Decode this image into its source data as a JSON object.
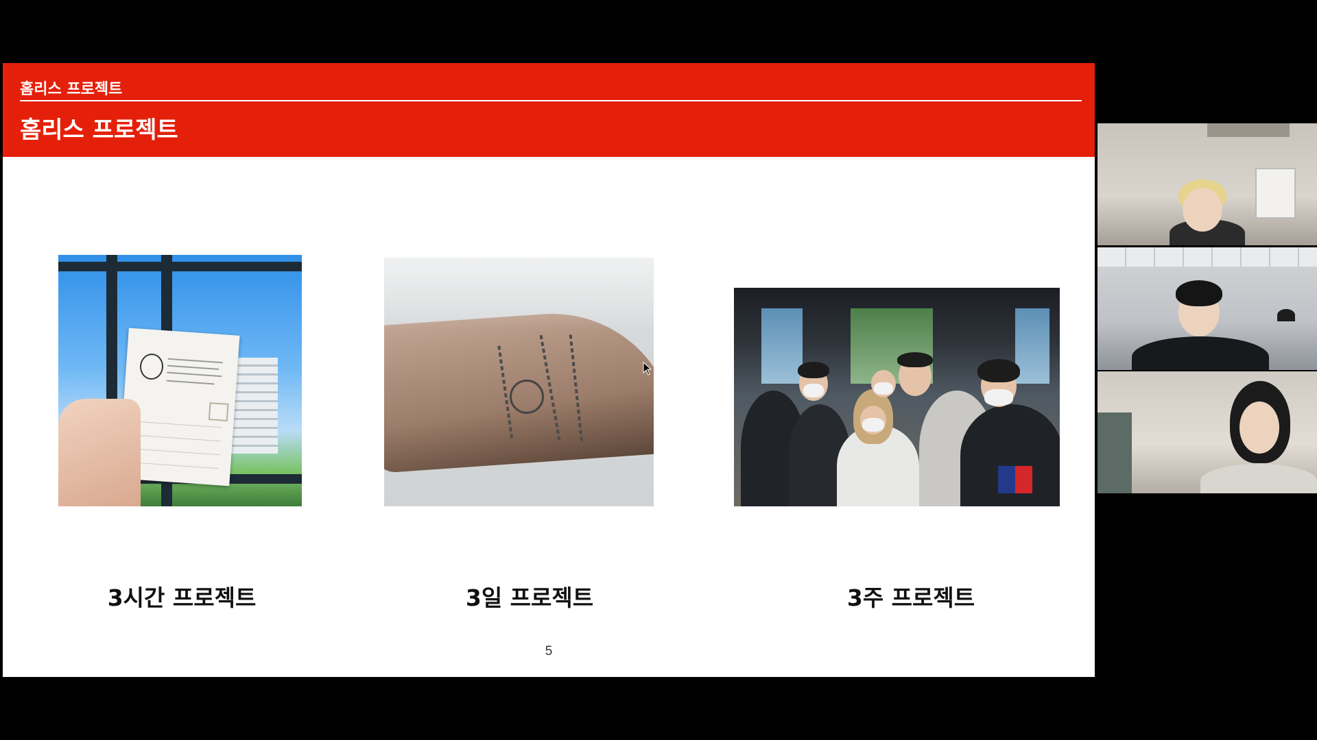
{
  "slide": {
    "section_label": "홈리스 프로젝트",
    "title": "홈리스 프로젝트",
    "page_number": "5",
    "projects": [
      {
        "caption": "3시간 프로젝트"
      },
      {
        "caption": "3일 프로젝트"
      },
      {
        "caption": "3주 프로젝트"
      }
    ],
    "colors": {
      "header": "#e5200a",
      "background": "#ffffff"
    }
  },
  "participants": [
    {
      "tile": "participant-1"
    },
    {
      "tile": "participant-2"
    },
    {
      "tile": "participant-3"
    }
  ]
}
